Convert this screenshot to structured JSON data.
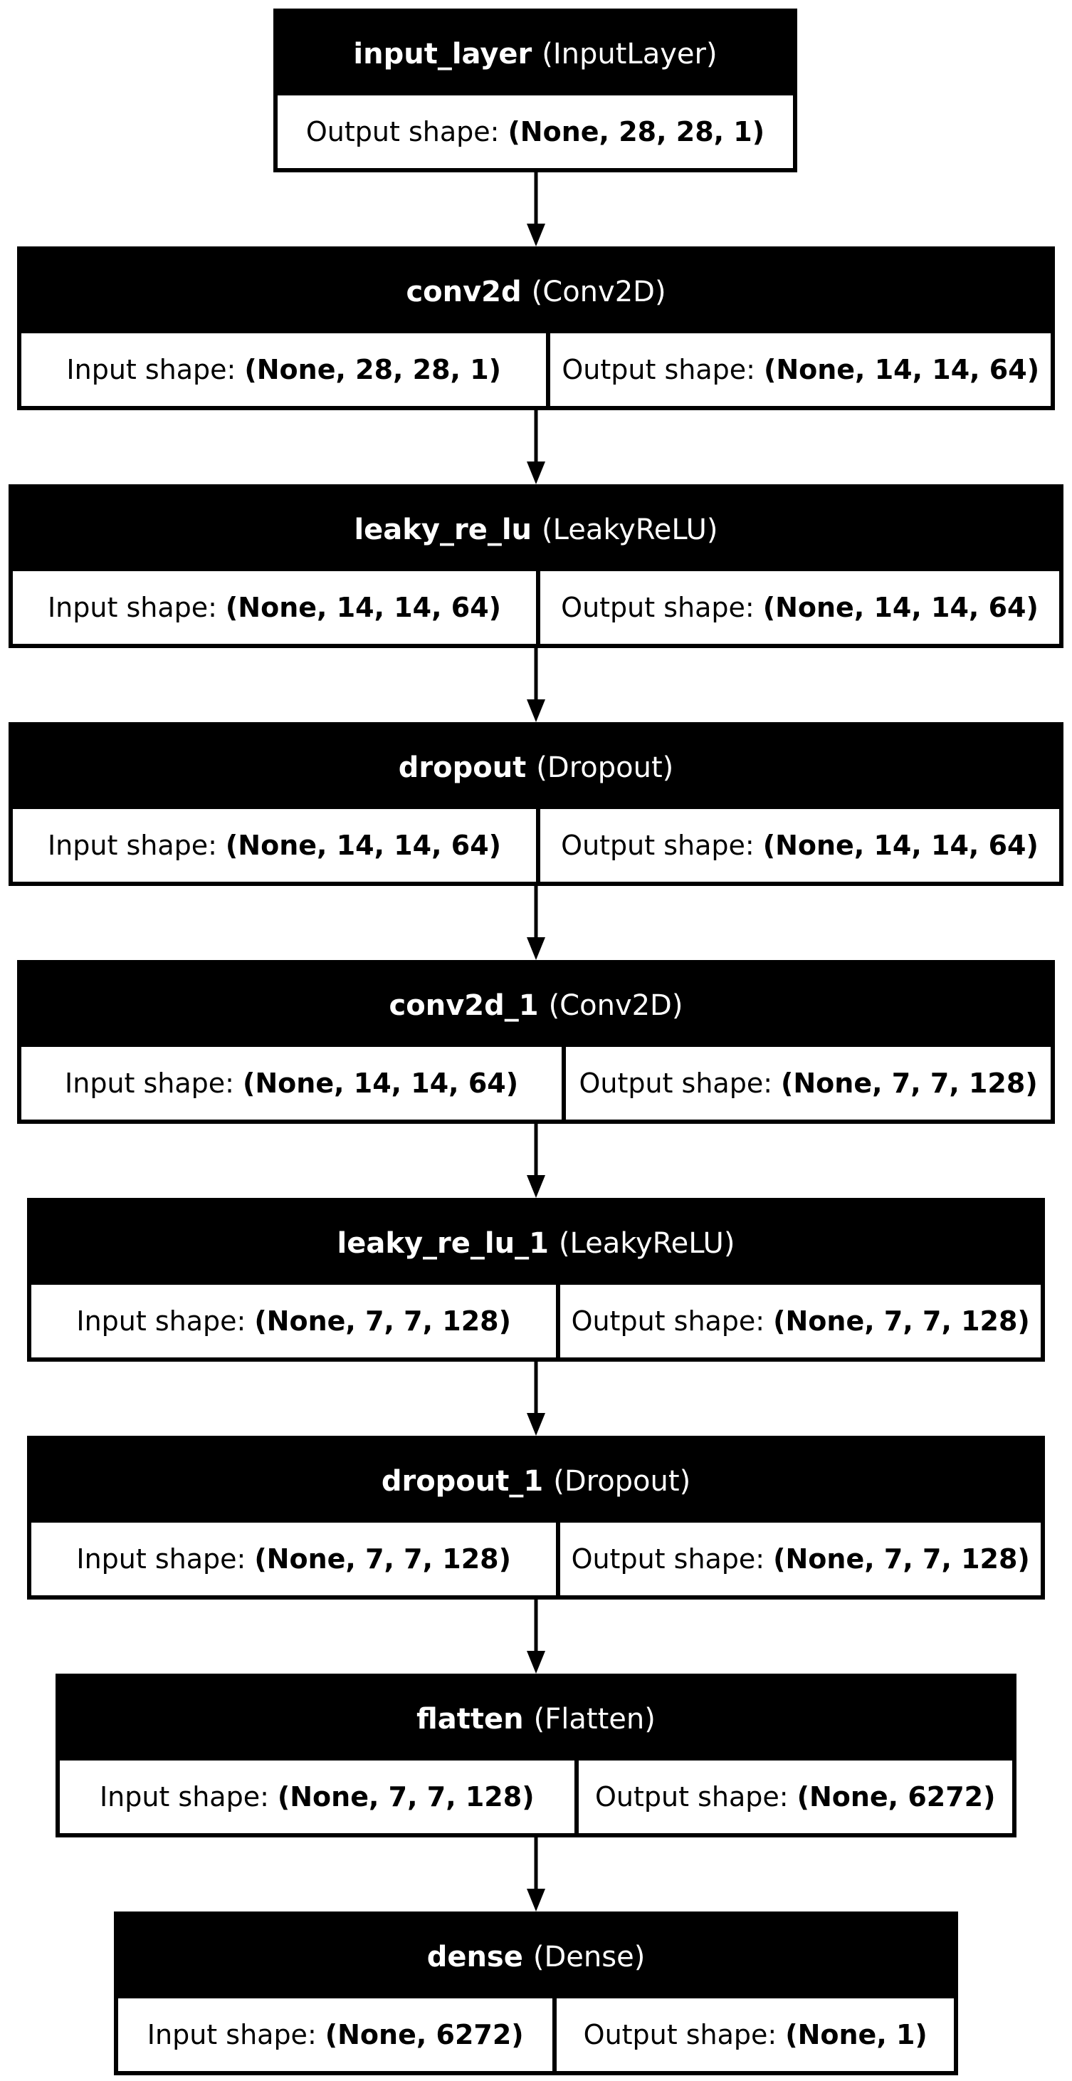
{
  "layers": [
    {
      "name": "input_layer",
      "type": "(InputLayer)",
      "input": null,
      "output": {
        "label": "Output shape:",
        "value": "(None, 28, 28, 1)"
      }
    },
    {
      "name": "conv2d",
      "type": "(Conv2D)",
      "input": {
        "label": "Input shape:",
        "value": "(None, 28, 28, 1)"
      },
      "output": {
        "label": "Output shape:",
        "value": "(None, 14, 14, 64)"
      }
    },
    {
      "name": "leaky_re_lu",
      "type": "(LeakyReLU)",
      "input": {
        "label": "Input shape:",
        "value": "(None, 14, 14, 64)"
      },
      "output": {
        "label": "Output shape:",
        "value": "(None, 14, 14, 64)"
      }
    },
    {
      "name": "dropout",
      "type": "(Dropout)",
      "input": {
        "label": "Input shape:",
        "value": "(None, 14, 14, 64)"
      },
      "output": {
        "label": "Output shape:",
        "value": "(None, 14, 14, 64)"
      }
    },
    {
      "name": "conv2d_1",
      "type": "(Conv2D)",
      "input": {
        "label": "Input shape:",
        "value": "(None, 14, 14, 64)"
      },
      "output": {
        "label": "Output shape:",
        "value": "(None, 7, 7, 128)"
      }
    },
    {
      "name": "leaky_re_lu_1",
      "type": "(LeakyReLU)",
      "input": {
        "label": "Input shape:",
        "value": "(None, 7, 7, 128)"
      },
      "output": {
        "label": "Output shape:",
        "value": "(None, 7, 7, 128)"
      }
    },
    {
      "name": "dropout_1",
      "type": "(Dropout)",
      "input": {
        "label": "Input shape:",
        "value": "(None, 7, 7, 128)"
      },
      "output": {
        "label": "Output shape:",
        "value": "(None, 7, 7, 128)"
      }
    },
    {
      "name": "flatten",
      "type": "(Flatten)",
      "input": {
        "label": "Input shape:",
        "value": "(None, 7, 7, 128)"
      },
      "output": {
        "label": "Output shape:",
        "value": "(None, 6272)"
      }
    },
    {
      "name": "dense",
      "type": "(Dense)",
      "input": {
        "label": "Input shape:",
        "value": "(None, 6272)"
      },
      "output": {
        "label": "Output shape:",
        "value": "(None, 1)"
      }
    }
  ],
  "colors": {
    "node_header": "#000000",
    "node_body": "#ffffff",
    "edge": "#000000"
  }
}
